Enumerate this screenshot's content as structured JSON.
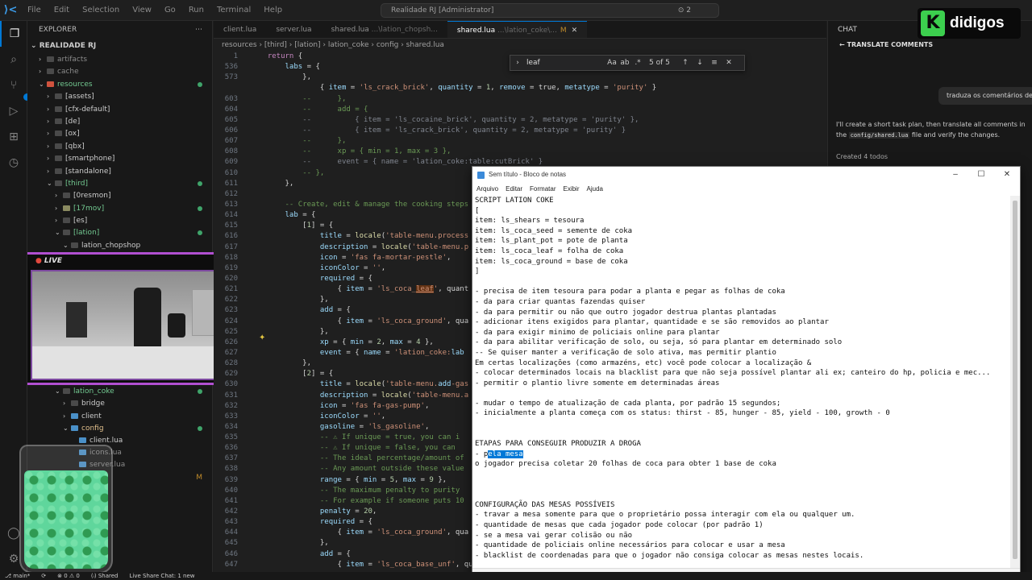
{
  "titlebar": {
    "logo": "⟩<",
    "menu": [
      "File",
      "Edit",
      "Selection",
      "View",
      "Go",
      "Run",
      "Terminal",
      "Help"
    ],
    "command_center": "Realidade RJ [Administrator]",
    "agent_count": "⊙ 2"
  },
  "explorer": {
    "header": "EXPLORER",
    "root": "REALIDADE RJ",
    "rows": [
      {
        "indent": 1,
        "chev": "›",
        "icon": "dim",
        "label": "artifacts",
        "color": "gray"
      },
      {
        "indent": 1,
        "chev": "›",
        "icon": "dim",
        "label": "cache",
        "color": "gray"
      },
      {
        "indent": 1,
        "chev": "⌄",
        "icon": "red",
        "label": "resources",
        "color": "green",
        "dot": true
      },
      {
        "indent": 2,
        "chev": "›",
        "icon": "dim",
        "label": "[assets]",
        "color": "white"
      },
      {
        "indent": 2,
        "chev": "›",
        "icon": "dim",
        "label": "[cfx-default]",
        "color": "white"
      },
      {
        "indent": 2,
        "chev": "›",
        "icon": "dim",
        "label": "[de]",
        "color": "white"
      },
      {
        "indent": 2,
        "chev": "›",
        "icon": "dim",
        "label": "[ox]",
        "color": "white"
      },
      {
        "indent": 2,
        "chev": "›",
        "icon": "dim",
        "label": "[qbx]",
        "color": "white"
      },
      {
        "indent": 2,
        "chev": "›",
        "icon": "dim",
        "label": "[smartphone]",
        "color": "white"
      },
      {
        "indent": 2,
        "chev": "›",
        "icon": "dim",
        "label": "[standalone]",
        "color": "white"
      },
      {
        "indent": 2,
        "chev": "⌄",
        "icon": "dim",
        "label": "[third]",
        "color": "green",
        "dot": true
      },
      {
        "indent": 3,
        "chev": "›",
        "icon": "dim",
        "label": "[0resmon]",
        "color": "white"
      },
      {
        "indent": 3,
        "chev": "›",
        "icon": "yellow",
        "label": "[17mov]",
        "color": "green",
        "dot": true
      },
      {
        "indent": 3,
        "chev": "›",
        "icon": "dim",
        "label": "[es]",
        "color": "white"
      },
      {
        "indent": 3,
        "chev": "⌄",
        "icon": "dim",
        "label": "[lation]",
        "color": "green",
        "dot": true
      },
      {
        "indent": 4,
        "chev": "⌄",
        "icon": "dim",
        "label": "lation_chopshop",
        "color": "white"
      }
    ],
    "rows_bottom": [
      {
        "indent": 3,
        "chev": "⌄",
        "icon": "dim",
        "label": "lation_coke",
        "color": "green",
        "dot": true
      },
      {
        "indent": 4,
        "chev": "›",
        "icon": "dim",
        "label": "bridge",
        "color": "white"
      },
      {
        "indent": 4,
        "chev": "›",
        "icon": "blue",
        "label": "client",
        "color": "white"
      },
      {
        "indent": 4,
        "chev": "⌄",
        "icon": "blue",
        "label": "config",
        "color": "yellow",
        "dot": true
      },
      {
        "indent": 5,
        "chev": "",
        "icon": "blue",
        "label": "client.lua",
        "color": "white"
      },
      {
        "indent": 5,
        "chev": "",
        "icon": "blue",
        "label": "icons.lua",
        "color": "gray"
      },
      {
        "indent": 5,
        "chev": "",
        "icon": "blue",
        "label": "server.lua",
        "color": "gray"
      },
      {
        "indent": 5,
        "chev": "",
        "icon": "blue",
        "label": "",
        "color": "gray",
        "mark": "M"
      }
    ]
  },
  "webcam": {
    "live_label": "LIVE"
  },
  "tabs": [
    {
      "label": "client.lua",
      "dim": "",
      "active": false
    },
    {
      "label": "server.lua",
      "dim": "",
      "active": false
    },
    {
      "label": "shared.lua",
      "dim": " ...\\lation_chopsh...",
      "active": false
    },
    {
      "label": "shared.lua",
      "dim": " ...\\lation_coke\\...",
      "active": true,
      "mod": "M"
    }
  ],
  "breadcrumb": "resources › [third] › [lation] › lation_coke › config › shared.lua",
  "find": {
    "query": "leaf",
    "count": "5 of 5"
  },
  "code_lines": [
    {
      "n": "1",
      "t": "  return {"
    },
    {
      "n": "536",
      "t": "      labs = {"
    },
    {
      "n": "573",
      "t": "          },"
    },
    {
      "n": "",
      "t": "              { item = 'ls_crack_brick', quantity = 1, remove = true, metatype = 'purity' }"
    },
    {
      "n": "603",
      "t": "          --      },"
    },
    {
      "n": "604",
      "t": "          --      add = {"
    },
    {
      "n": "605",
      "t": "          --          { item = 'ls_cocaine_brick', quantity = 2, metatype = 'purity' },"
    },
    {
      "n": "606",
      "t": "          --          { item = 'ls_crack_brick', quantity = 2, metatype = 'purity' }"
    },
    {
      "n": "607",
      "t": "          --      },"
    },
    {
      "n": "608",
      "t": "          --      xp = { min = 1, max = 3 },"
    },
    {
      "n": "609",
      "t": "          --      event = { name = 'lation_coke:table:cutBrick' }"
    },
    {
      "n": "610",
      "t": "          -- },"
    },
    {
      "n": "611",
      "t": "      },"
    },
    {
      "n": "612",
      "t": ""
    },
    {
      "n": "613",
      "t": "      -- Create, edit & manage the cooking steps"
    },
    {
      "n": "614",
      "t": "      lab = {"
    },
    {
      "n": "615",
      "t": "          [1] = {"
    },
    {
      "n": "616",
      "t": "              title = locale('table-menu.process"
    },
    {
      "n": "617",
      "t": "              description = locale('table-menu.p"
    },
    {
      "n": "618",
      "t": "              icon = 'fas fa-mortar-pestle',"
    },
    {
      "n": "619",
      "t": "              iconColor = '',"
    },
    {
      "n": "620",
      "t": "              required = {"
    },
    {
      "n": "621",
      "t": "                  { item = 'ls_coca_leaf', quant"
    },
    {
      "n": "622",
      "t": "              },"
    },
    {
      "n": "623",
      "t": "              add = {"
    },
    {
      "n": "624",
      "t": "                  { item = 'ls_coca_ground', qua"
    },
    {
      "n": "625",
      "t": "              },"
    },
    {
      "n": "626",
      "t": "              xp = { min = 2, max = 4 },"
    },
    {
      "n": "627",
      "t": "              event = { name = 'lation_coke:lab"
    },
    {
      "n": "628",
      "t": "          },"
    },
    {
      "n": "629",
      "t": "          [2] = {"
    },
    {
      "n": "630",
      "t": "              title = locale('table-menu.add-gas"
    },
    {
      "n": "631",
      "t": "              description = locale('table-menu.a"
    },
    {
      "n": "632",
      "t": "              icon = 'fas fa-gas-pump',"
    },
    {
      "n": "633",
      "t": "              iconColor = '',"
    },
    {
      "n": "634",
      "t": "              gasoline = 'ls_gasoline',"
    },
    {
      "n": "635",
      "t": "              -- ⚠ If unique = true, you can i"
    },
    {
      "n": "636",
      "t": "              -- ⚠ If unique = false, you can"
    },
    {
      "n": "637",
      "t": "              -- The ideal percentage/amount of"
    },
    {
      "n": "638",
      "t": "              -- Any amount outside these value"
    },
    {
      "n": "639",
      "t": "              range = { min = 5, max = 9 },"
    },
    {
      "n": "640",
      "t": "              -- The maximum penalty to purity"
    },
    {
      "n": "641",
      "t": "              -- For example if someone puts 10"
    },
    {
      "n": "642",
      "t": "              penalty = 20,"
    },
    {
      "n": "643",
      "t": "              required = {"
    },
    {
      "n": "644",
      "t": "                  { item = 'ls_coca_ground', qua"
    },
    {
      "n": "645",
      "t": "              },"
    },
    {
      "n": "646",
      "t": "              add = {"
    },
    {
      "n": "647",
      "t": "                  { item = 'ls_coca_base_unf', qua"
    }
  ],
  "chat": {
    "header": "CHAT",
    "title": "TRANSLATE COMMENTS",
    "user_msg": "traduza os comentários des",
    "response_a": "I'll create a short task plan, then translate all comments in the",
    "response_code": "config/shared.lua",
    "response_b": " file and verify the changes.",
    "todos": "Created 4 todos"
  },
  "brand": {
    "mark": "K",
    "name": "didigos"
  },
  "notepad": {
    "title": "Sem título - Bloco de notas",
    "menu": [
      "Arquivo",
      "Editar",
      "Formatar",
      "Exibir",
      "Ajuda"
    ],
    "lines": [
      "SCRIPT LATION COKE",
      "[",
      "item: ls_shears = tesoura",
      "item: ls_coca_seed = semente de coka",
      "item: ls_plant_pot = pote de planta",
      "item: ls_coca_leaf = folha de coka",
      "item: ls_coca_ground = base de coka",
      "]",
      "",
      "- precisa de item tesoura para podar a planta e pegar as folhas de coka",
      "- da para criar quantas fazendas quiser",
      "- da para permitir ou não que outro jogador destrua plantas plantadas",
      "- adicionar itens exigidos para plantar, quantidade e se são removidos ao plantar",
      "- da para exigir minimo de policiais online para plantar",
      "- da para abilitar verificação de solo, ou seja, só para plantar em determinado solo",
      "-- Se quiser manter a verificação de solo ativa, mas permitir plantio",
      "Em certas localizações (como armazéns, etc) você pode colocar a localização &",
      "- colocar determinados locais na blacklist para que não seja possível plantar ali ex; canteiro do hp, policia e mec...",
      "- permitir o plantio livre somente em determinadas áreas",
      "",
      "- mudar o tempo de atualização de cada planta, por padrão 15 segundos;",
      "- inicialmente a planta começa com os status: thirst - 85, hunger - 85, yield - 100, growth - 0",
      "",
      "",
      "ETAPAS PARA CONSEGUIR PRODUZIR A DROGA",
      "__SEL__",
      "o jogador precisa coletar 20 folhas de coca para obter 1 base de coka",
      "",
      "",
      "",
      "CONFIGURAÇÃO DAS MESAS POSSÍVEIS",
      "- travar a mesa somente para que o proprietário possa interagir com ela ou qualquer um.",
      "- quantidade de mesas que cada jogador pode colocar (por padrão 1)",
      "- se a mesa vai gerar colisão ou não",
      "- quantidade de policiais online necessários para colocar e usar a mesa",
      "- blacklist de coordenadas para que o jogador não consiga colocar as mesas nestes locais."
    ],
    "sel_prefix": "- p",
    "sel_text": "ela mesa"
  },
  "statusbar": [
    "⎇ main*",
    "⟳",
    "⊗ 0  ⚠ 0",
    "(ᵢ) Shared",
    "Live Share Chat: 1 new"
  ]
}
